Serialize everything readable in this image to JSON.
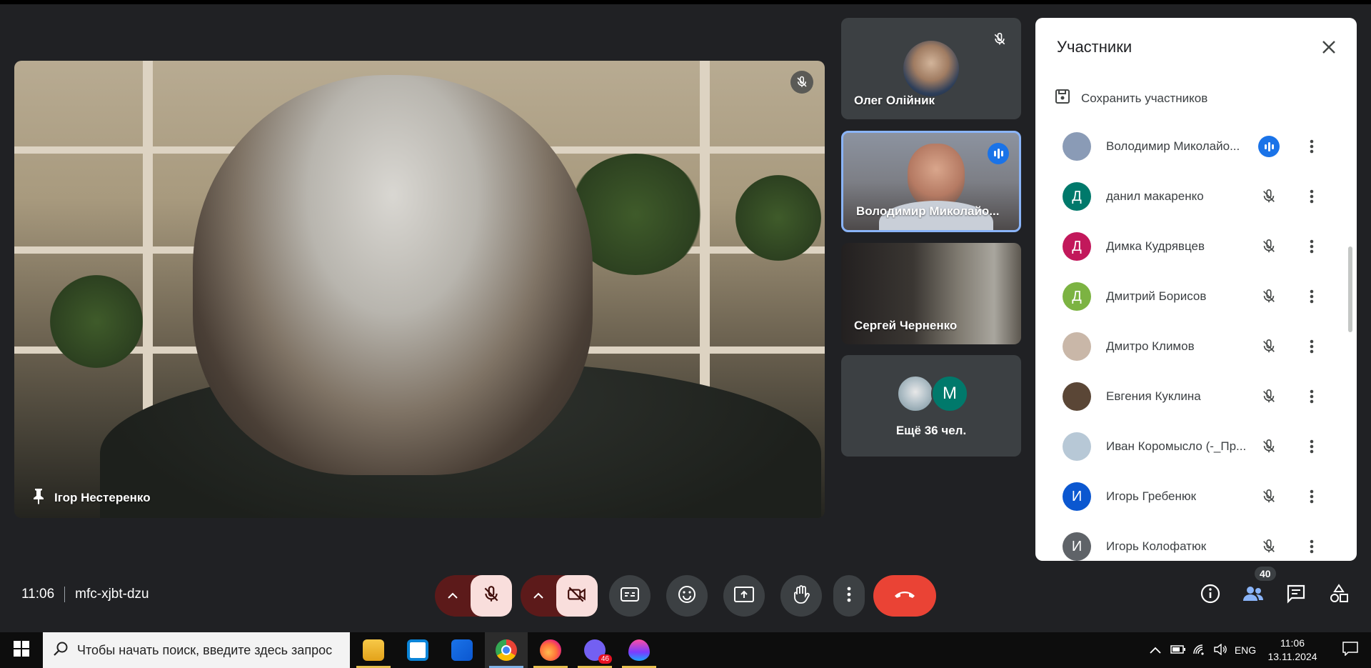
{
  "main_tile": {
    "name": "Ігор Нестеренко"
  },
  "side_tiles": [
    {
      "name": "Олег Олійник"
    },
    {
      "name": "Володимир Миколайо..."
    },
    {
      "name": "Сергей Черненко"
    }
  ],
  "more_tile": {
    "avatar_letter": "М",
    "label": "Ещё 36 чел."
  },
  "panel": {
    "title": "Участники",
    "save_label": "Сохранить участников",
    "participants": [
      {
        "name": "Володимир Миколайо...",
        "avatar": "",
        "avatar_color": "#8a9bb6",
        "speaking": true
      },
      {
        "name": "данил макаренко",
        "avatar": "Д",
        "avatar_color": "#00796b",
        "speaking": false
      },
      {
        "name": "Димка Кудрявцев",
        "avatar": "Д",
        "avatar_color": "#c2185b",
        "speaking": false
      },
      {
        "name": "Дмитрий Борисов",
        "avatar": "Д",
        "avatar_color": "#7cb342",
        "speaking": false
      },
      {
        "name": "Дмитро Климов",
        "avatar": "",
        "avatar_color": "#c9b7a8",
        "speaking": false
      },
      {
        "name": "Евгения Куклина",
        "avatar": "",
        "avatar_color": "#5a4636",
        "speaking": false
      },
      {
        "name": "Иван Коромысло (-_Пр...",
        "avatar": "",
        "avatar_color": "#b7c8d6",
        "speaking": false
      },
      {
        "name": "Игорь Гребенюк",
        "avatar": "И",
        "avatar_color": "#0b57d0",
        "speaking": false
      },
      {
        "name": "Игорь Колофатюк",
        "avatar": "И",
        "avatar_color": "#5f6368",
        "speaking": false
      }
    ]
  },
  "bottom": {
    "time": "11:06",
    "meeting_code": "mfc-xjbt-dzu",
    "participant_count": "40"
  },
  "taskbar": {
    "search_placeholder": "Чтобы начать поиск, введите здесь запрос",
    "viber_badge": "46",
    "lang": "ENG",
    "time": "11:06",
    "date": "13.11.2024"
  },
  "colors": {
    "accent": "#1a73e8",
    "end_call": "#ea4335",
    "mic_off_bg": "#f9dedc"
  }
}
